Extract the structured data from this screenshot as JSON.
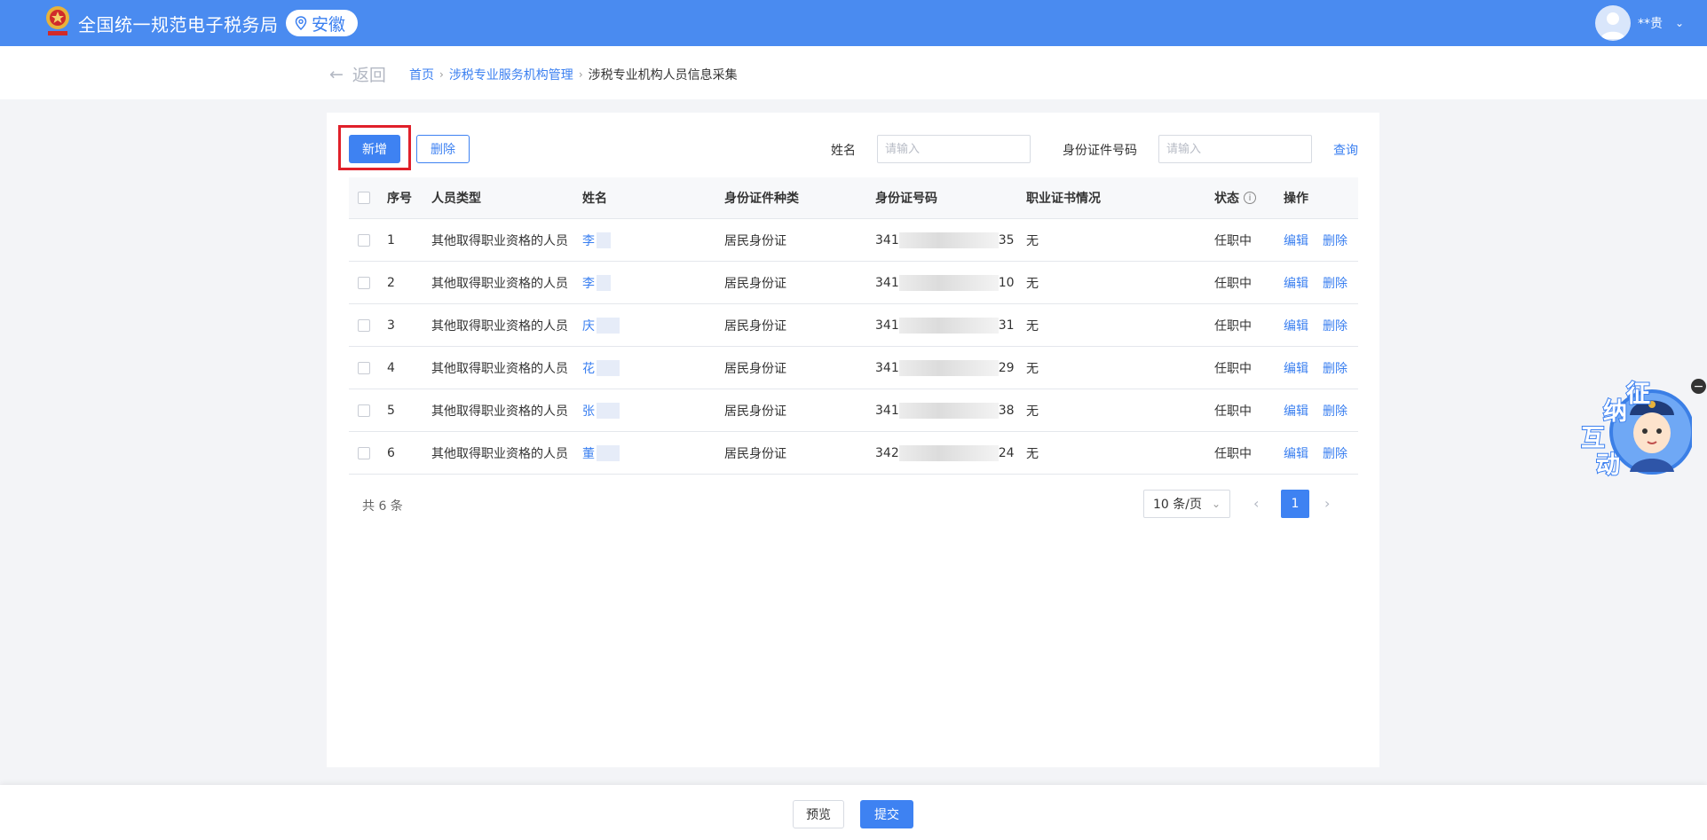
{
  "header": {
    "site_title": "全国统一规范电子税务局",
    "region": "安徽",
    "user_name": "**贵"
  },
  "nav": {
    "back_label": "返回",
    "breadcrumb": [
      "首页",
      "涉税专业服务机构管理",
      "涉税专业机构人员信息采集"
    ]
  },
  "toolbar": {
    "add_label": "新增",
    "delete_label": "删除",
    "name_label": "姓名",
    "name_placeholder": "请输入",
    "id_label": "身份证件号码",
    "id_placeholder": "请输入",
    "query_label": "查询"
  },
  "table": {
    "columns": [
      "序号",
      "人员类型",
      "姓名",
      "身份证件种类",
      "身份证号码",
      "职业证书情况",
      "状态",
      "操作"
    ],
    "rows": [
      {
        "index": "1",
        "type": "其他取得职业资格的人员",
        "name": "李",
        "id_type": "居民身份证",
        "id_prefix": "341",
        "id_suffix": "35",
        "cert": "无",
        "status": "任职中",
        "edit": "编辑",
        "delete": "删除"
      },
      {
        "index": "2",
        "type": "其他取得职业资格的人员",
        "name": "李",
        "id_type": "居民身份证",
        "id_prefix": "341",
        "id_suffix": "10",
        "cert": "无",
        "status": "任职中",
        "edit": "编辑",
        "delete": "删除"
      },
      {
        "index": "3",
        "type": "其他取得职业资格的人员",
        "name": "庆",
        "id_type": "居民身份证",
        "id_prefix": "341",
        "id_suffix": "31",
        "cert": "无",
        "status": "任职中",
        "edit": "编辑",
        "delete": "删除"
      },
      {
        "index": "4",
        "type": "其他取得职业资格的人员",
        "name": "花",
        "id_type": "居民身份证",
        "id_prefix": "341",
        "id_suffix": "29",
        "cert": "无",
        "status": "任职中",
        "edit": "编辑",
        "delete": "删除"
      },
      {
        "index": "5",
        "type": "其他取得职业资格的人员",
        "name": "张",
        "id_type": "居民身份证",
        "id_prefix": "341",
        "id_suffix": "38",
        "cert": "无",
        "status": "任职中",
        "edit": "编辑",
        "delete": "删除"
      },
      {
        "index": "6",
        "type": "其他取得职业资格的人员",
        "name": "董",
        "id_type": "居民身份证",
        "id_prefix": "342",
        "id_suffix": "24",
        "cert": "无",
        "status": "任职中",
        "edit": "编辑",
        "delete": "删除"
      }
    ]
  },
  "pagination": {
    "total_text": "共 6 条",
    "page_size": "10 条/页",
    "current_page": "1"
  },
  "footer": {
    "preview_label": "预览",
    "submit_label": "提交"
  },
  "widget": {
    "chars": [
      "征",
      "纳",
      "互",
      "动"
    ]
  },
  "colors": {
    "header_bg": "#4a8bf0",
    "primary": "#3e82f2",
    "highlight_box": "#e0202a"
  },
  "icons": [
    "tax-emblem-icon",
    "location-pin-icon",
    "user-avatar-icon",
    "chevron-down-icon",
    "arrow-left-icon",
    "chevron-right-icon",
    "info-icon",
    "chevron-left-icon",
    "close-icon"
  ]
}
